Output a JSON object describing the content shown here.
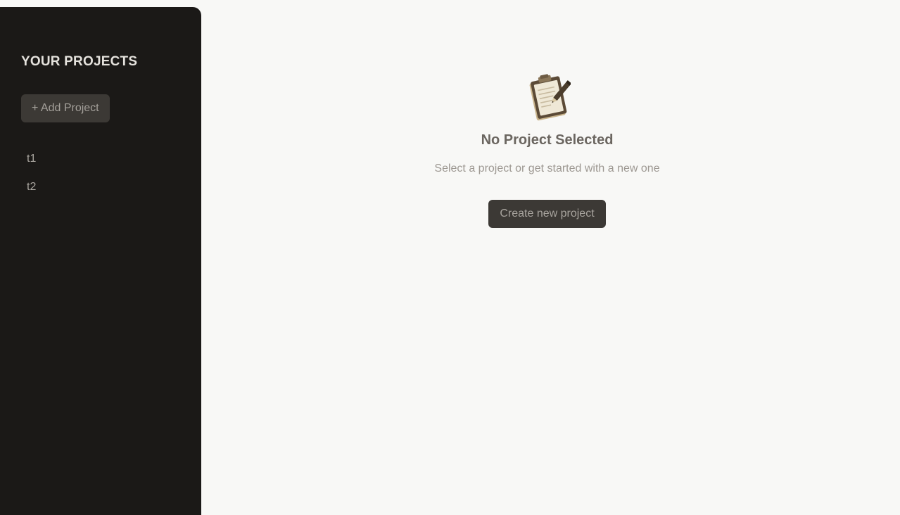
{
  "sidebar": {
    "title": "YOUR PROJECTS",
    "add_button_label": "+ Add Project",
    "projects": [
      {
        "label": "t1"
      },
      {
        "label": "t2"
      }
    ]
  },
  "main": {
    "icon": "clipboard-pencil-icon",
    "title": "No Project Selected",
    "subtitle": "Select a project or get started with a new one",
    "create_button_label": "Create new project"
  },
  "colors": {
    "sidebar_bg": "#1b1917",
    "main_bg": "#f8f8f6",
    "button_bg": "#3c3935"
  }
}
